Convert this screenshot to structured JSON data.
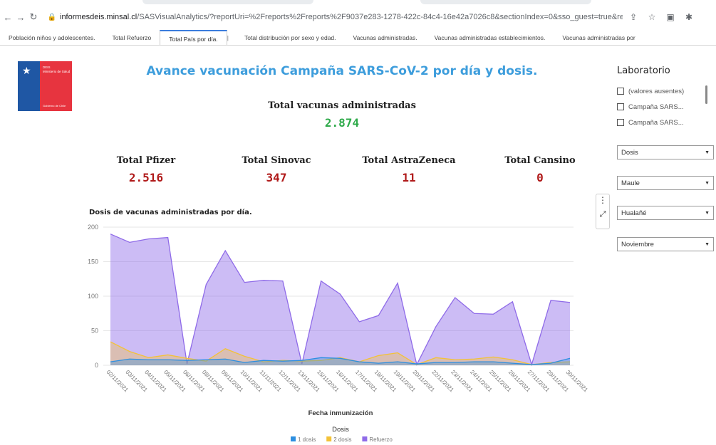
{
  "browser": {
    "url_host": "informesdeis.minsal.cl",
    "url_rest": "/SASVisualAnalytics/?reportUri=%2Freports%2Freports%2F9037e283-1278-422c-84c4-16e42a7026c8&sectionIndex=0&sso_guest=true&reportVie..."
  },
  "report_tabs": [
    "Población niños y adolescentes.",
    "Total Refuerzo",
    "Total País por día.",
    "Total distribución por sexo y edad.",
    "Vacunas administradas.",
    "Vacunas administradas establecimientos.",
    "Vacunas administradas por"
  ],
  "active_tab": 2,
  "logo": {
    "line1": "DEIS",
    "line2": "Ministerio de Salud",
    "line3": "Gobierno de Chile"
  },
  "title": "Avance vacunación Campaña SARS-CoV-2 por día y dosis.",
  "total": {
    "label": "Total vacunas administradas",
    "value": "2.874",
    "color": "#2eaa4a"
  },
  "kpis": [
    {
      "label": "Total Pfizer",
      "value": "2.516"
    },
    {
      "label": "Total Sinovac",
      "value": "347"
    },
    {
      "label": "Total AstraZeneca",
      "value": "11"
    },
    {
      "label": "Total Cansino",
      "value": "0"
    }
  ],
  "kpi_color": "#b01a1a",
  "filters": {
    "lab_title": "Laboratorio",
    "lab_options": [
      "(valores ausentes)",
      "Campaña SARS...",
      "Campaña SARS..."
    ],
    "dosis": "Dosis",
    "region": "Maule",
    "comuna": "Hualañé",
    "mes": "Noviembre"
  },
  "chart_data": {
    "type": "area",
    "title": "Dosis de vacunas administradas por día.",
    "xlabel": "Fecha inmunización",
    "ylabel": "",
    "ylim": [
      0,
      200
    ],
    "yticks": [
      0,
      50,
      100,
      150,
      200
    ],
    "x": [
      "02/11/2021",
      "03/11/2021",
      "04/11/2021",
      "05/11/2021",
      "06/11/2021",
      "08/11/2021",
      "09/11/2021",
      "10/11/2021",
      "11/11/2021",
      "12/11/2021",
      "13/11/2021",
      "15/11/2021",
      "16/11/2021",
      "17/11/2021",
      "18/11/2021",
      "19/11/2021",
      "20/11/2021",
      "22/11/2021",
      "23/11/2021",
      "24/11/2021",
      "25/11/2021",
      "26/11/2021",
      "27/11/2021",
      "29/11/2021",
      "30/11/2021"
    ],
    "legend_title": "Dosis",
    "series": [
      {
        "name": "1 dosis",
        "color": "#2d8fe0",
        "values": [
          5,
          9,
          8,
          8,
          7,
          8,
          9,
          4,
          7,
          6,
          7,
          11,
          10,
          5,
          3,
          5,
          2,
          4,
          4,
          5,
          5,
          3,
          1,
          3,
          10
        ]
      },
      {
        "name": "2 dosis",
        "color": "#f3c238",
        "values": [
          34,
          20,
          11,
          15,
          10,
          6,
          24,
          13,
          5,
          7,
          6,
          7,
          11,
          5,
          14,
          18,
          1,
          11,
          8,
          9,
          12,
          8,
          1,
          4,
          5
        ]
      },
      {
        "name": "Refuerzo",
        "color": "#8f6be8",
        "values": [
          190,
          178,
          183,
          185,
          2,
          117,
          166,
          120,
          123,
          122,
          2,
          122,
          103,
          63,
          72,
          119,
          1,
          56,
          98,
          75,
          74,
          92,
          1,
          94,
          91
        ]
      }
    ]
  }
}
